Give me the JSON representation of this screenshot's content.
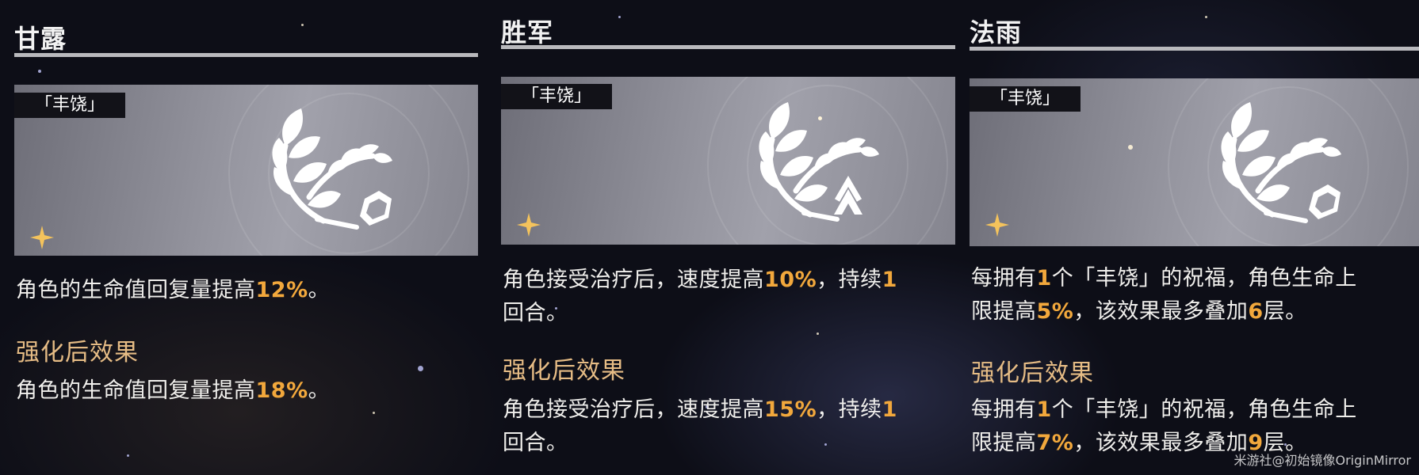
{
  "panels": [
    {
      "title": "甘露",
      "tag": "「丰饶」",
      "emblem": "abundance-emblem-shield",
      "base_effect": {
        "pre": "角色的生命值回复量提高",
        "value": "12%",
        "post": "。"
      },
      "enhanced_heading": "强化后效果",
      "enhanced_effect": {
        "pre": "角色的生命值回复量提高",
        "value": "18%",
        "post": "。"
      }
    },
    {
      "title": "胜军",
      "tag": "「丰饶」",
      "emblem": "abundance-emblem-chevron",
      "base_effect": {
        "pre": "角色接受治疗后，速度提高",
        "value": "10%",
        "mid": "，持续",
        "value2": "1",
        "line2": "回合。"
      },
      "enhanced_heading": "强化后效果",
      "enhanced_effect": {
        "pre": "角色接受治疗后，速度提高",
        "value": "15%",
        "mid": "，持续",
        "value2": "1",
        "line2": "回合。"
      }
    },
    {
      "title": "法雨",
      "tag": "「丰饶」",
      "emblem": "abundance-emblem-shield",
      "base_effect": {
        "pre": "每拥有",
        "value": "1",
        "mid": "个「丰饶」的祝福，角色生命上",
        "line2_pre": "限提高",
        "value2": "5%",
        "line2_mid": "，该效果最多叠加",
        "value3": "6",
        "line2_post": "层。"
      },
      "enhanced_heading": "强化后效果",
      "enhanced_effect": {
        "pre": "每拥有",
        "value": "1",
        "mid": "个「丰饶」的祝福，角色生命上",
        "line2_pre": "限提高",
        "value2": "7%",
        "line2_mid": "，该效果最多叠加",
        "value3": "9",
        "line2_post": "层。"
      }
    }
  ],
  "watermark": "米游社@初始镜像OriginMirror",
  "colors": {
    "highlight": "#f2a83c",
    "heading": "#e6bc85",
    "sparkle": "#f4c35c"
  }
}
